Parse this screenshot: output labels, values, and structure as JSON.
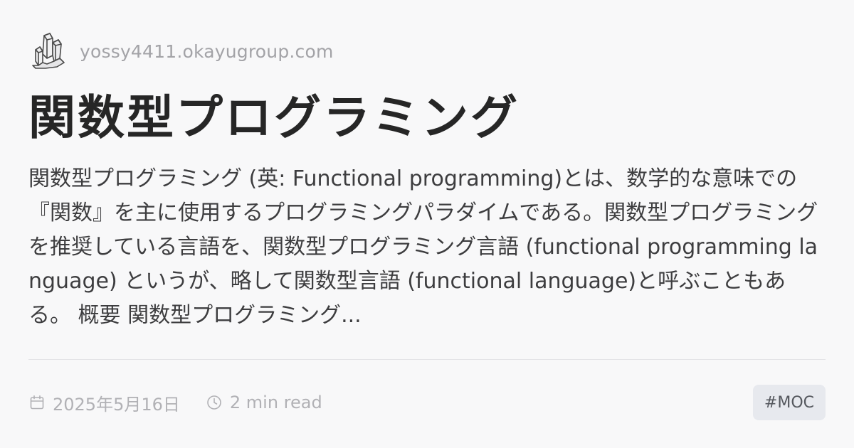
{
  "site": {
    "name": "yossy4411.okayugroup.com",
    "logo_icon": "crystal-icon"
  },
  "article": {
    "title": "関数型プログラミング",
    "excerpt": "関数型プログラミング (英: Functional programming)とは、数学的な意味での『関数』を主に使用するプログラミングパラダイムである。関数型プログラミングを推奨している言語を、関数型プログラミング言語 (functional programming language) というが、略して関数型言語 (functional language)と呼ぶこともある。 概要 関数型プログラミング..."
  },
  "meta": {
    "date": "2025年5月16日",
    "date_icon": "calendar-icon",
    "read_time": "2 min read",
    "read_icon": "clock-icon"
  },
  "tags": [
    "#MOC"
  ],
  "colors": {
    "background": "#f8f8f9",
    "title": "#262626",
    "muted": "#a3a3a7",
    "tag_bg": "#e7e9ee"
  }
}
